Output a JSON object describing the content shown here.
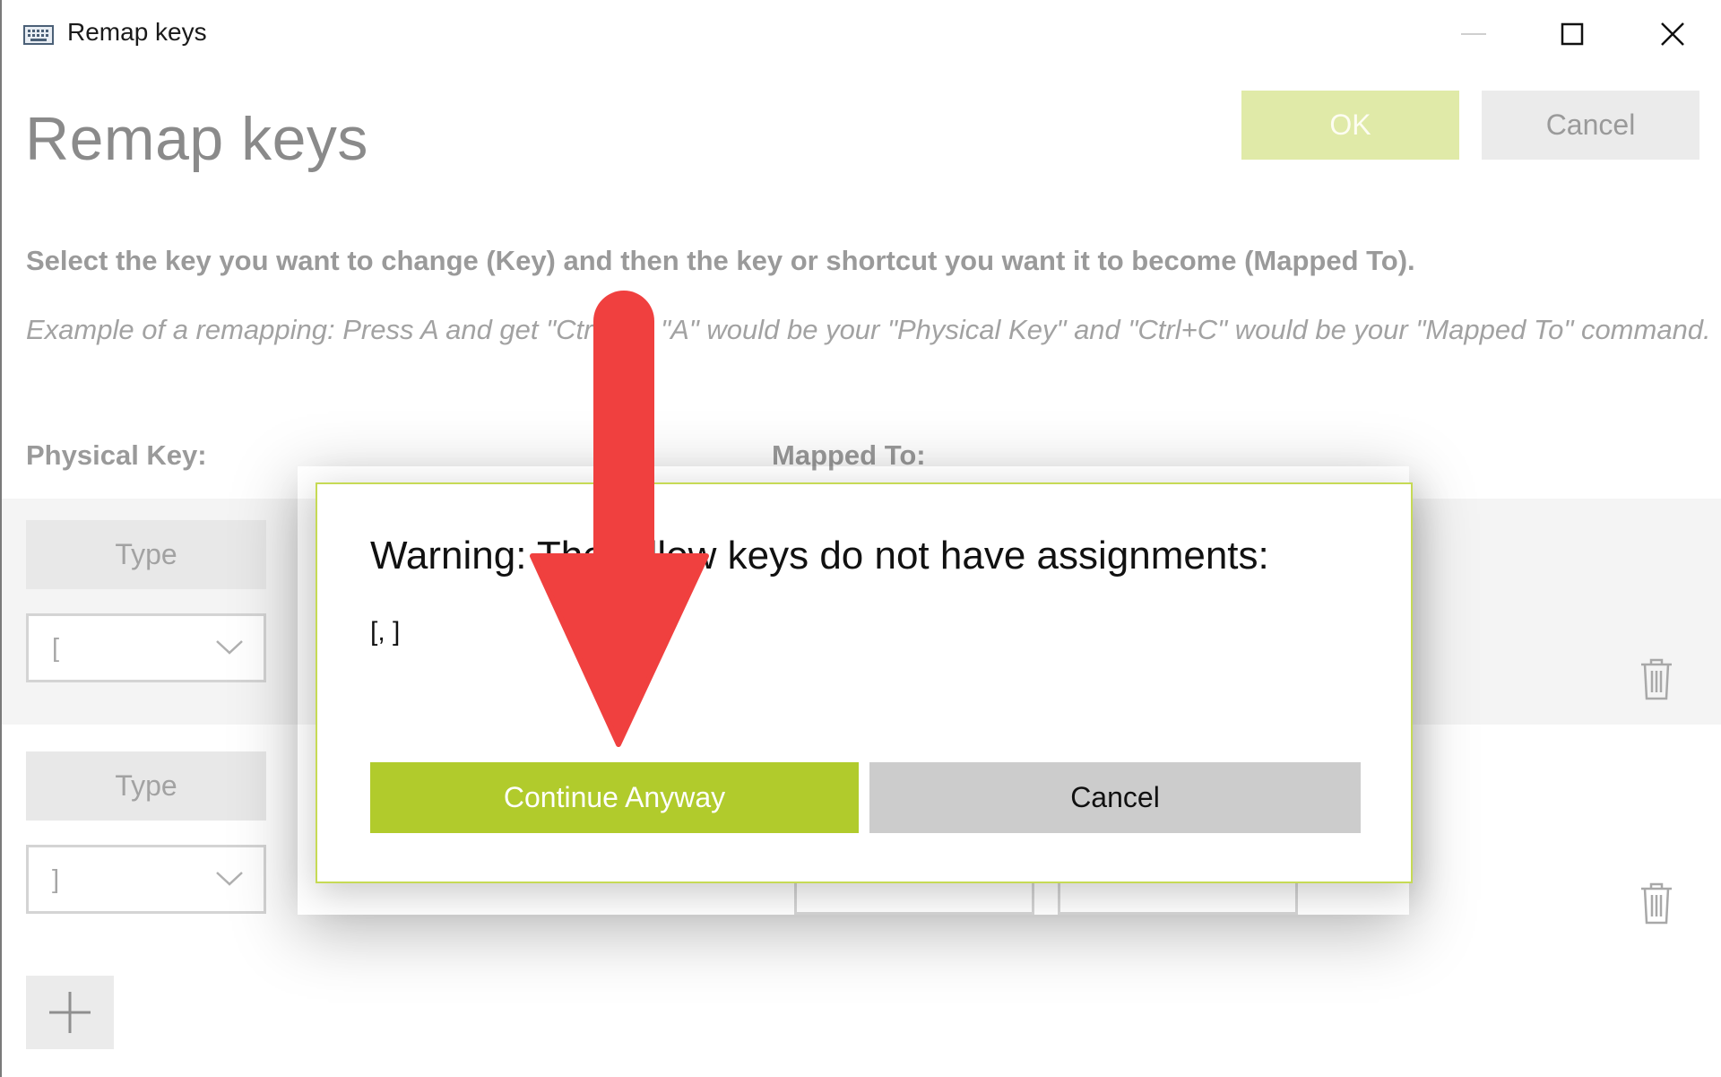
{
  "window": {
    "title": "Remap keys",
    "controls": {
      "minimize": "minimize",
      "maximize": "maximize",
      "close": "close"
    }
  },
  "header": {
    "title": "Remap keys",
    "ok_label": "OK",
    "cancel_label": "Cancel"
  },
  "instructions": {
    "main": "Select the key you want to change (Key) and then the key or shortcut you want it to become (Mapped To).",
    "example": "Example of a remapping: Press A and get \"Ctrl+C\", \"A\" would be your \"Physical Key\" and \"Ctrl+C\" would be your \"Mapped To\" command."
  },
  "columns": {
    "physical": "Physical Key:",
    "mapped": "Mapped To:"
  },
  "rows": [
    {
      "type_label": "Type",
      "selected_key": "["
    },
    {
      "type_label": "Type",
      "selected_key": "]"
    }
  ],
  "dialog": {
    "title": "Warning: The follow keys do not have assignments:",
    "keys": "[, ]",
    "continue_label": "Continue Anyway",
    "cancel_label": "Cancel"
  },
  "icons": {
    "app": "keyboard-icon",
    "dropdown": "chevron-down-icon",
    "delete": "trash-icon",
    "add": "plus-icon",
    "annotation": "red-arrow-icon"
  },
  "colors": {
    "accent": "#b1cb2c",
    "accent_disabled": "#e0eaa8",
    "dialog_border": "#c6da55",
    "arrow": "#f0403f"
  }
}
